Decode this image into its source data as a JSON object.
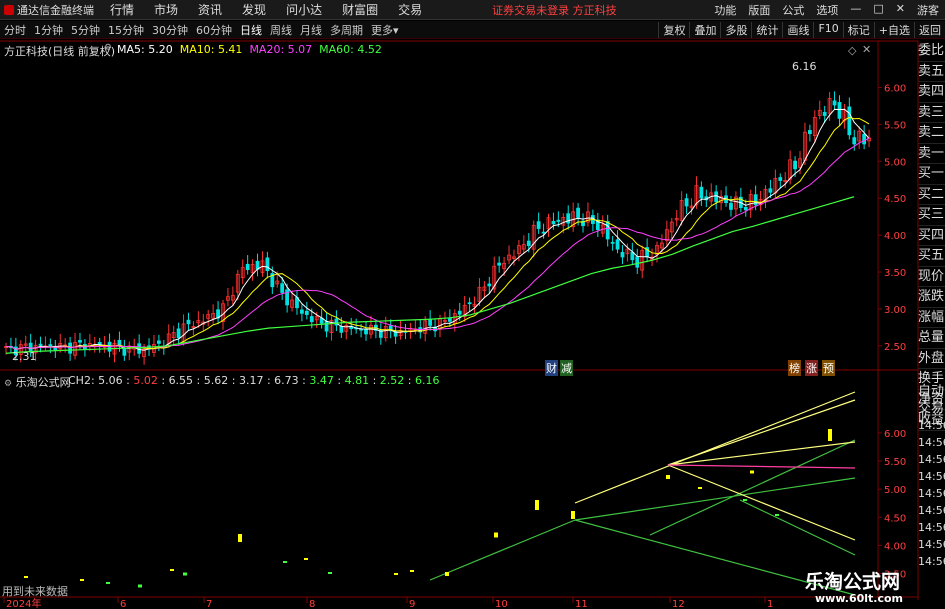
{
  "menubar": {
    "app_name": "通达信金融终端",
    "items": [
      "行情",
      "市场",
      "资讯",
      "发现",
      "问小达",
      "财富圈",
      "交易"
    ],
    "notice": "证券交易未登录  方正科技",
    "right_items": [
      "功能",
      "版面",
      "公式",
      "选项"
    ],
    "user": "游客"
  },
  "periodbar": {
    "periods": [
      "分时",
      "1分钟",
      "5分钟",
      "15分钟",
      "30分钟",
      "60分钟",
      "日线",
      "周线",
      "月线",
      "多周期",
      "更多"
    ],
    "active": "日线",
    "tools": [
      "复权",
      "叠加",
      "多股",
      "统计",
      "画线",
      "F10",
      "标记",
      "+自选",
      "返回"
    ]
  },
  "main_chart": {
    "stock_label": "方正科技(日线 前复权)",
    "ma": [
      {
        "name": "MA5",
        "value": "5.20",
        "color": "#ffffff"
      },
      {
        "name": "MA10",
        "value": "5.41",
        "color": "#ffff00"
      },
      {
        "name": "MA20",
        "value": "5.07",
        "color": "#ff40ff"
      },
      {
        "name": "MA60",
        "value": "4.52",
        "color": "#40ff40"
      }
    ],
    "high_label": "6.16",
    "low_label": "2.31",
    "markers": [
      {
        "text": "财",
        "color": "#4080ff"
      },
      {
        "text": "减",
        "color": "#40c040"
      },
      {
        "text": "榜",
        "color": "#ff8000"
      },
      {
        "text": "涨",
        "color": "#ff4040"
      },
      {
        "text": "预",
        "color": "#ffa000"
      }
    ]
  },
  "sub_chart": {
    "title": "乐淘公式网",
    "label": "CH2",
    "value": "5.06",
    "values": [
      "5.02",
      "6.55",
      "5.62",
      "3.17",
      "6.73",
      "3.47",
      "4.81",
      "2.52",
      "6.16"
    ],
    "value_colors": [
      "#ff4040",
      "#c8c8c8",
      "#c8c8c8",
      "#c8c8c8",
      "#c8c8c8",
      "#40ff40",
      "#40ff40",
      "#40ff40",
      "#40ff40"
    ],
    "footer_text": "用到未来数据"
  },
  "right_panel": [
    "委比",
    "卖五",
    "卖四",
    "卖三",
    "卖二",
    "卖一",
    "买一",
    "买二",
    "买三",
    "买四",
    "买五",
    "现价",
    "涨跌",
    "涨幅",
    "总量",
    "外盘",
    "换手",
    "净资",
    "收益"
  ],
  "right_panel2": [
    "自动",
    "交易",
    "14:56",
    "14:56",
    "14:56",
    "14:56",
    "14:56",
    "14:56",
    "14:56",
    "14:56",
    "14:56"
  ],
  "watermark": {
    "title": "乐淘公式网",
    "url": "www.60lt.com"
  },
  "chart_data": [
    {
      "type": "candlestick",
      "title": "方正科技(日线 前复权)",
      "x_ticks": [
        "2024年",
        "6",
        "7",
        "8",
        "9",
        "10",
        "11",
        "12",
        "1"
      ],
      "ylim": [
        2.2,
        6.4
      ],
      "y_ticks": [
        2.5,
        3.0,
        3.5,
        4.0,
        4.5,
        5.0,
        5.5,
        6.0
      ],
      "ohlc_close_trend": [
        2.45,
        2.48,
        2.5,
        2.48,
        2.52,
        2.5,
        2.46,
        2.44,
        2.55,
        2.75,
        2.85,
        3.0,
        3.55,
        3.6,
        3.2,
        2.95,
        2.8,
        2.75,
        2.72,
        2.7,
        2.68,
        2.75,
        2.8,
        2.95,
        3.2,
        3.6,
        3.8,
        4.1,
        4.2,
        4.25,
        4.15,
        3.8,
        3.65,
        3.8,
        4.3,
        4.55,
        4.5,
        4.4,
        4.45,
        4.7,
        4.95,
        5.6,
        5.8,
        5.3
      ],
      "series": [
        {
          "name": "MA60",
          "values": [
            2.4,
            2.42,
            2.43,
            2.44,
            2.45,
            2.46,
            2.47,
            2.48,
            2.5,
            2.55,
            2.6,
            2.65,
            2.7,
            2.74,
            2.76,
            2.78,
            2.8,
            2.82,
            2.83,
            2.84,
            2.85,
            2.86,
            2.88,
            2.92,
            3.0,
            3.08,
            3.18,
            3.28,
            3.38,
            3.48,
            3.55,
            3.6,
            3.66,
            3.74,
            3.85,
            3.95,
            4.05,
            4.12,
            4.2,
            4.28,
            4.36,
            4.44,
            4.52
          ]
        }
      ]
    },
    {
      "type": "scatter",
      "title": "乐淘公式网",
      "ylim": [
        3.1,
        6.8
      ],
      "y_ticks": [
        3.5,
        4.0,
        4.5,
        5.0,
        5.5,
        6.0
      ],
      "series": [
        {
          "name": "CH2",
          "values": [
            5.06
          ]
        }
      ]
    }
  ]
}
